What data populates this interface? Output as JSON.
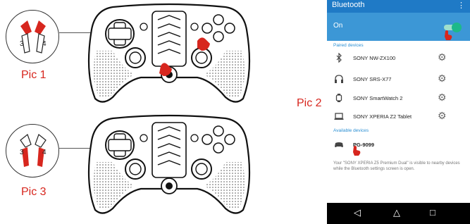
{
  "figure": {
    "labels": [
      "Pic 1",
      "Pic 2",
      "Pic 3"
    ],
    "pic1_trigger_numbers": [
      "3",
      "4"
    ],
    "pic3_trigger_numbers": [
      "3",
      "4"
    ],
    "accent_color": "#d7261e"
  },
  "phone": {
    "title": "Bluetooth",
    "menu_icon": "⋮",
    "switch_label": "On",
    "switch_on": true,
    "paired_header": "Paired devices",
    "paired": [
      {
        "icon": "bluetooth-icon",
        "name": "SONY NW-ZX100"
      },
      {
        "icon": "headphones-icon",
        "name": "SONY SRS-X77"
      },
      {
        "icon": "watch-icon",
        "name": "SONY SmartWatch 2"
      },
      {
        "icon": "laptop-icon",
        "name": "SONY XPERIA Z2 Tablet"
      }
    ],
    "available_header": "Available devices",
    "available": [
      {
        "icon": "gamepad-icon",
        "name": "PG-9099"
      }
    ],
    "visibility_note": "Your \"SONY XPERIA Z5 Premium Dual\" is visible to nearby devices while the Bluetooth settings screen is open.",
    "nav": {
      "back": "◁",
      "home": "△",
      "recent": "□"
    },
    "colors": {
      "bar": "#1f7ac6",
      "switch_row": "#3c97d6",
      "toggle": "#1db98a"
    }
  }
}
